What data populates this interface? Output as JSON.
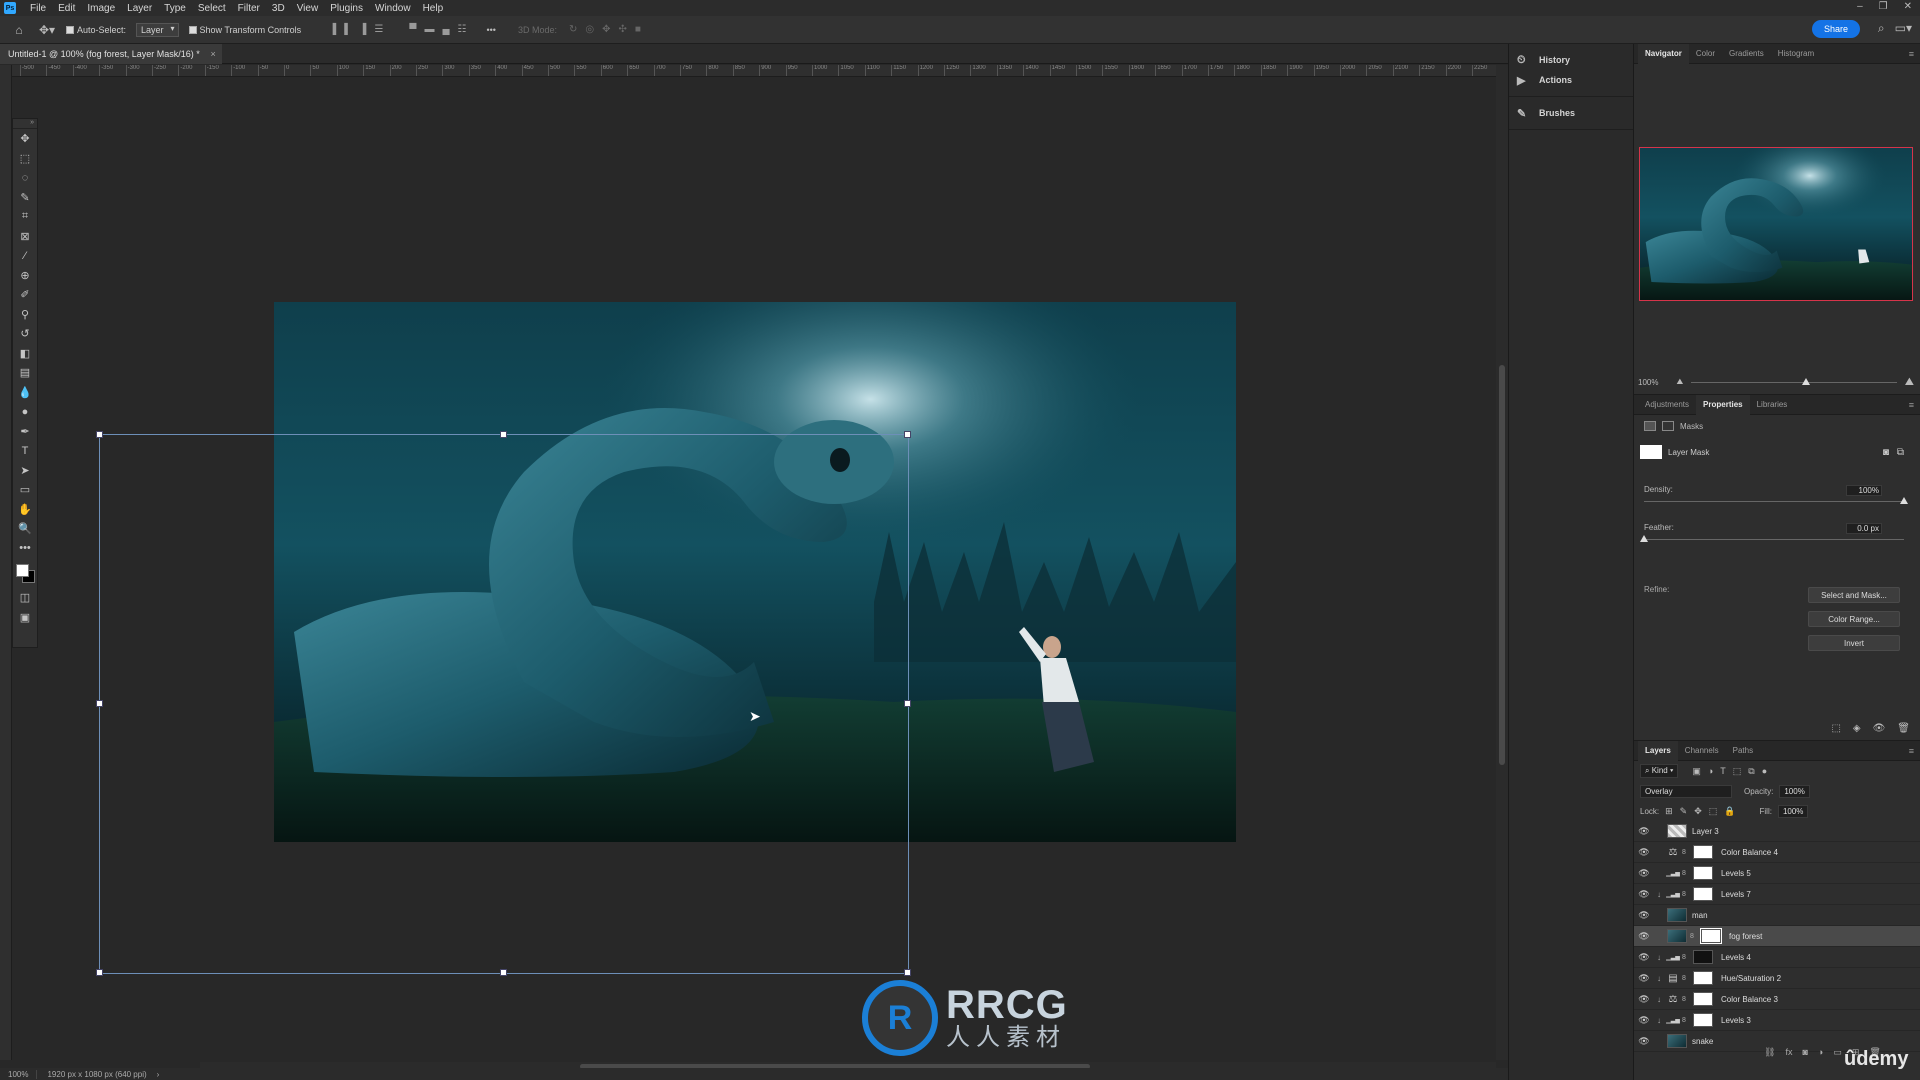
{
  "menu": {
    "logo": "Ps",
    "items": [
      "File",
      "Edit",
      "Image",
      "Layer",
      "Type",
      "Select",
      "Filter",
      "3D",
      "View",
      "Plugins",
      "Window",
      "Help"
    ],
    "window_controls": [
      "–",
      "❐",
      "✕"
    ]
  },
  "options": {
    "auto_select_label": "Auto-Select:",
    "auto_select_target": "Layer",
    "show_transform_label": "Show Transform Controls",
    "mode_3d_label": "3D Mode:",
    "more": "•••",
    "share_label": "Share"
  },
  "document": {
    "tab_title": "Untitled-1 @ 100% (fog forest, Layer Mask/16) *",
    "close": "×"
  },
  "ruler_ticks": [
    "-500",
    "-450",
    "-400",
    "-350",
    "-300",
    "-250",
    "-200",
    "-150",
    "-100",
    "-50",
    "0",
    "50",
    "100",
    "150",
    "200",
    "250",
    "300",
    "350",
    "400",
    "450",
    "500",
    "550",
    "600",
    "650",
    "700",
    "750",
    "800",
    "850",
    "900",
    "950",
    "1000",
    "1050",
    "1100",
    "1150",
    "1200",
    "1250",
    "1300",
    "1350",
    "1400",
    "1450",
    "1500",
    "1550",
    "1600",
    "1650",
    "1700",
    "1750",
    "1800",
    "1850",
    "1900",
    "1950",
    "2000",
    "2050",
    "2100",
    "2150",
    "2200",
    "2250"
  ],
  "toolbar": {
    "tools": [
      "move-tool",
      "marquee-tool",
      "lasso-tool",
      "quick-select-tool",
      "crop-tool",
      "frame-tool",
      "eyedropper-tool",
      "healing-tool",
      "brush-tool",
      "stamp-tool",
      "history-brush-tool",
      "eraser-tool",
      "gradient-tool",
      "blur-tool",
      "dodge-tool",
      "pen-tool",
      "type-tool",
      "path-select-tool",
      "shape-tool",
      "hand-tool",
      "zoom-tool",
      "more-tools"
    ],
    "glyphs": [
      "✥",
      "⬚",
      "◌",
      "✎",
      "⌗",
      "⊠",
      "⁄",
      "⊕",
      "✐",
      "⚲",
      "↺",
      "◧",
      "▤",
      "💧",
      "●",
      "✒",
      "T",
      "➤",
      "▭",
      "✋",
      "🔍",
      "•••"
    ],
    "foreground_color": "#ffffff",
    "background_color": "#000000"
  },
  "status": {
    "zoom": "100%",
    "doc_info": "1920 px x 1080 px (640 ppi)"
  },
  "watermark": {
    "logo_text": "R",
    "title": "RRCG",
    "subtitle": "人人素材"
  },
  "mid_panel": {
    "items": [
      {
        "icon": "history-icon",
        "glyph": "⏲",
        "label": "History"
      },
      {
        "icon": "actions-icon",
        "glyph": "▶",
        "label": "Actions"
      },
      {
        "icon": "brushes-icon",
        "glyph": "✎",
        "label": "Brushes"
      }
    ]
  },
  "navigator": {
    "tabs": [
      "Navigator",
      "Color",
      "Gradients",
      "Histogram"
    ],
    "zoom": "100%"
  },
  "properties": {
    "tabs": [
      "Adjustments",
      "Properties",
      "Libraries"
    ],
    "masks_label": "Masks",
    "layer_mask_label": "Layer Mask",
    "density_label": "Density:",
    "density_value": "100%",
    "density_level": 1.0,
    "feather_label": "Feather:",
    "feather_value": "0.0 px",
    "feather_level": 0.0,
    "refine_label": "Refine:",
    "buttons": [
      "Select and Mask...",
      "Color Range...",
      "Invert"
    ]
  },
  "layers": {
    "tabs": [
      "Layers",
      "Channels",
      "Paths"
    ],
    "kind_label": "Kind",
    "blend_mode": "Overlay",
    "opacity_label": "Opacity:",
    "opacity_value": "100%",
    "lock_label": "Lock:",
    "fill_label": "Fill:",
    "fill_value": "100%",
    "rows": [
      {
        "name": "Layer 3",
        "type": "pixel",
        "clip": false,
        "selected": false
      },
      {
        "name": "Color Balance 4",
        "type": "adjust-balance",
        "clip": false,
        "selected": false
      },
      {
        "name": "Levels 5",
        "type": "adjust-levels",
        "clip": false,
        "selected": false
      },
      {
        "name": "Levels 7",
        "type": "adjust-levels",
        "clip": true,
        "selected": false
      },
      {
        "name": "man",
        "type": "smart",
        "clip": false,
        "selected": false
      },
      {
        "name": "fog forest",
        "type": "smart-mask",
        "clip": false,
        "selected": true
      },
      {
        "name": "Levels 4",
        "type": "adjust-levels-dark",
        "clip": true,
        "selected": false
      },
      {
        "name": "Hue/Saturation 2",
        "type": "adjust-hue",
        "clip": true,
        "selected": false
      },
      {
        "name": "Color Balance 3",
        "type": "adjust-balance",
        "clip": true,
        "selected": false
      },
      {
        "name": "Levels 3",
        "type": "adjust-levels",
        "clip": true,
        "selected": false
      },
      {
        "name": "snake",
        "type": "smart",
        "clip": false,
        "selected": false
      }
    ]
  },
  "udemy": "ûdemy",
  "colors": {
    "accent": "#1473e6",
    "navigator_frame": "#d6344a",
    "transform_frame": "#6d8fb8"
  }
}
